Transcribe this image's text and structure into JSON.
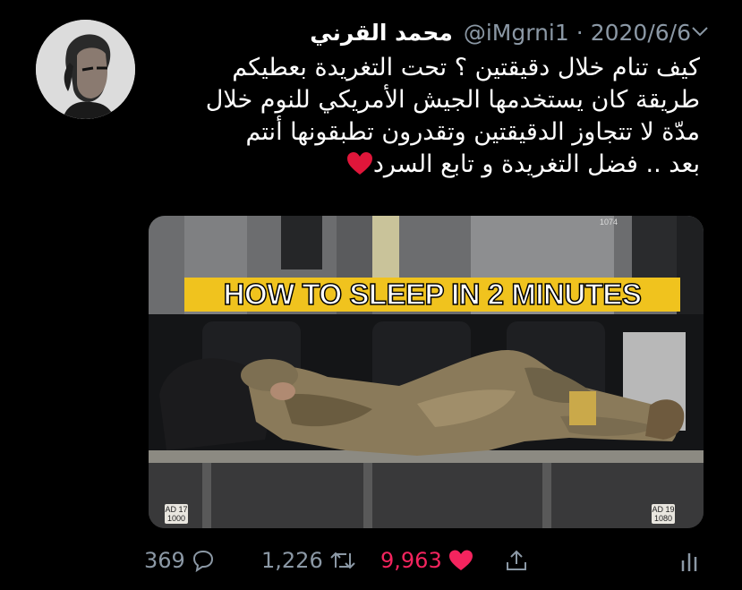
{
  "tweet": {
    "author_name": "محمد القرني",
    "handle": "@iMgrni1",
    "separator": "·",
    "date": "2020/6/6",
    "text_lines": [
      "كيف تنام خلال دقيقتين ؟ تحت التغريدة بعطيكم",
      "طريقة كان يستخدمها الجيش الأمريكي للنوم خلال",
      "مدّة لا تتجاوز الدقيقتين وتقدرون تطبقونها أنتم",
      "بعد .. فضل التغريدة و تابع السرد"
    ],
    "text_emoji": "red-heart-emoji"
  },
  "media": {
    "caption": "HOW TO SLEEP IN 2 MINUTES",
    "panel_number": "1074",
    "tag_left": [
      "AD 17",
      "1000"
    ],
    "tag_right": [
      "AD 19",
      "1080"
    ]
  },
  "actions": {
    "reply_count": "369",
    "retweet_count": "1,226",
    "like_count": "9,963",
    "like_color": "#f4245e",
    "muted_color": "#8b98a5"
  }
}
